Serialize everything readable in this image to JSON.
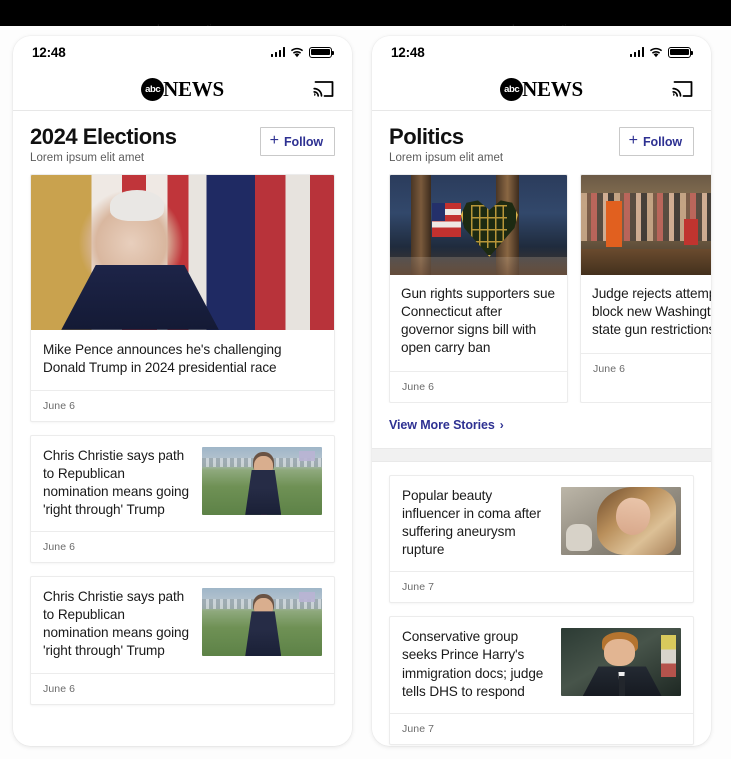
{
  "top_captions": {
    "left": "abcnews-section",
    "right": "abcnews-section"
  },
  "status_bar": {
    "time": "12:48",
    "signal_icon": "cellular-signal-icon",
    "wifi_icon": "wifi-icon",
    "battery_icon": "battery-full-icon"
  },
  "app_header": {
    "logo_mark": "abc",
    "logo_word": "NEWS",
    "cast_icon": "cast-icon"
  },
  "phones": [
    {
      "id": "left",
      "section": {
        "title": "2024 Elections",
        "subtitle": "Lorem ipsum elit amet",
        "follow_plus": "+",
        "follow_label": "Follow"
      },
      "hero": {
        "headline": "Mike Pence announces he's challenging Donald Trump in 2024 presidential race",
        "date": "June 6",
        "image": "mike-pence-podium-flags"
      },
      "list": [
        {
          "headline": "Chris Christie says path to Republican nomination means going 'right through' Trump",
          "date": "June 6",
          "image": "chris-christie-stadium-interview"
        },
        {
          "headline": "Chris Christie says path to Republican nomination means going 'right through' Trump",
          "date": "June 6",
          "image": "chris-christie-stadium-interview"
        }
      ]
    },
    {
      "id": "right",
      "section": {
        "title": "Politics",
        "subtitle": "Lorem ipsum elit amet",
        "follow_plus": "+",
        "follow_label": "Follow"
      },
      "carousel": [
        {
          "headline": "Gun rights supporters sue Connecticut after governor signs bill with open carry ban",
          "date": "June 6",
          "image": "memorial-heart-of-crosses-with-flag"
        },
        {
          "headline": "Judge rejects attempt to block new Washington state gun restrictions",
          "date": "June 6",
          "image": "crowd-at-bill-signing"
        }
      ],
      "view_more": {
        "label": "View More Stories",
        "chevron": "›"
      },
      "list": [
        {
          "headline": "Popular beauty influencer in coma after suffering aneurysm rupture",
          "date": "June 7",
          "image": "beauty-influencer-portrait"
        },
        {
          "headline": "Conservative group seeks Prince Harry's immigration docs; judge tells DHS to respond",
          "date": "June 7",
          "image": "prince-harry-portrait"
        }
      ]
    }
  ],
  "colors": {
    "brand_blue": "#2e3192",
    "page_background": "#fdfdfd",
    "card_border": "#ececec",
    "divider_band": "#f1f1f1"
  }
}
